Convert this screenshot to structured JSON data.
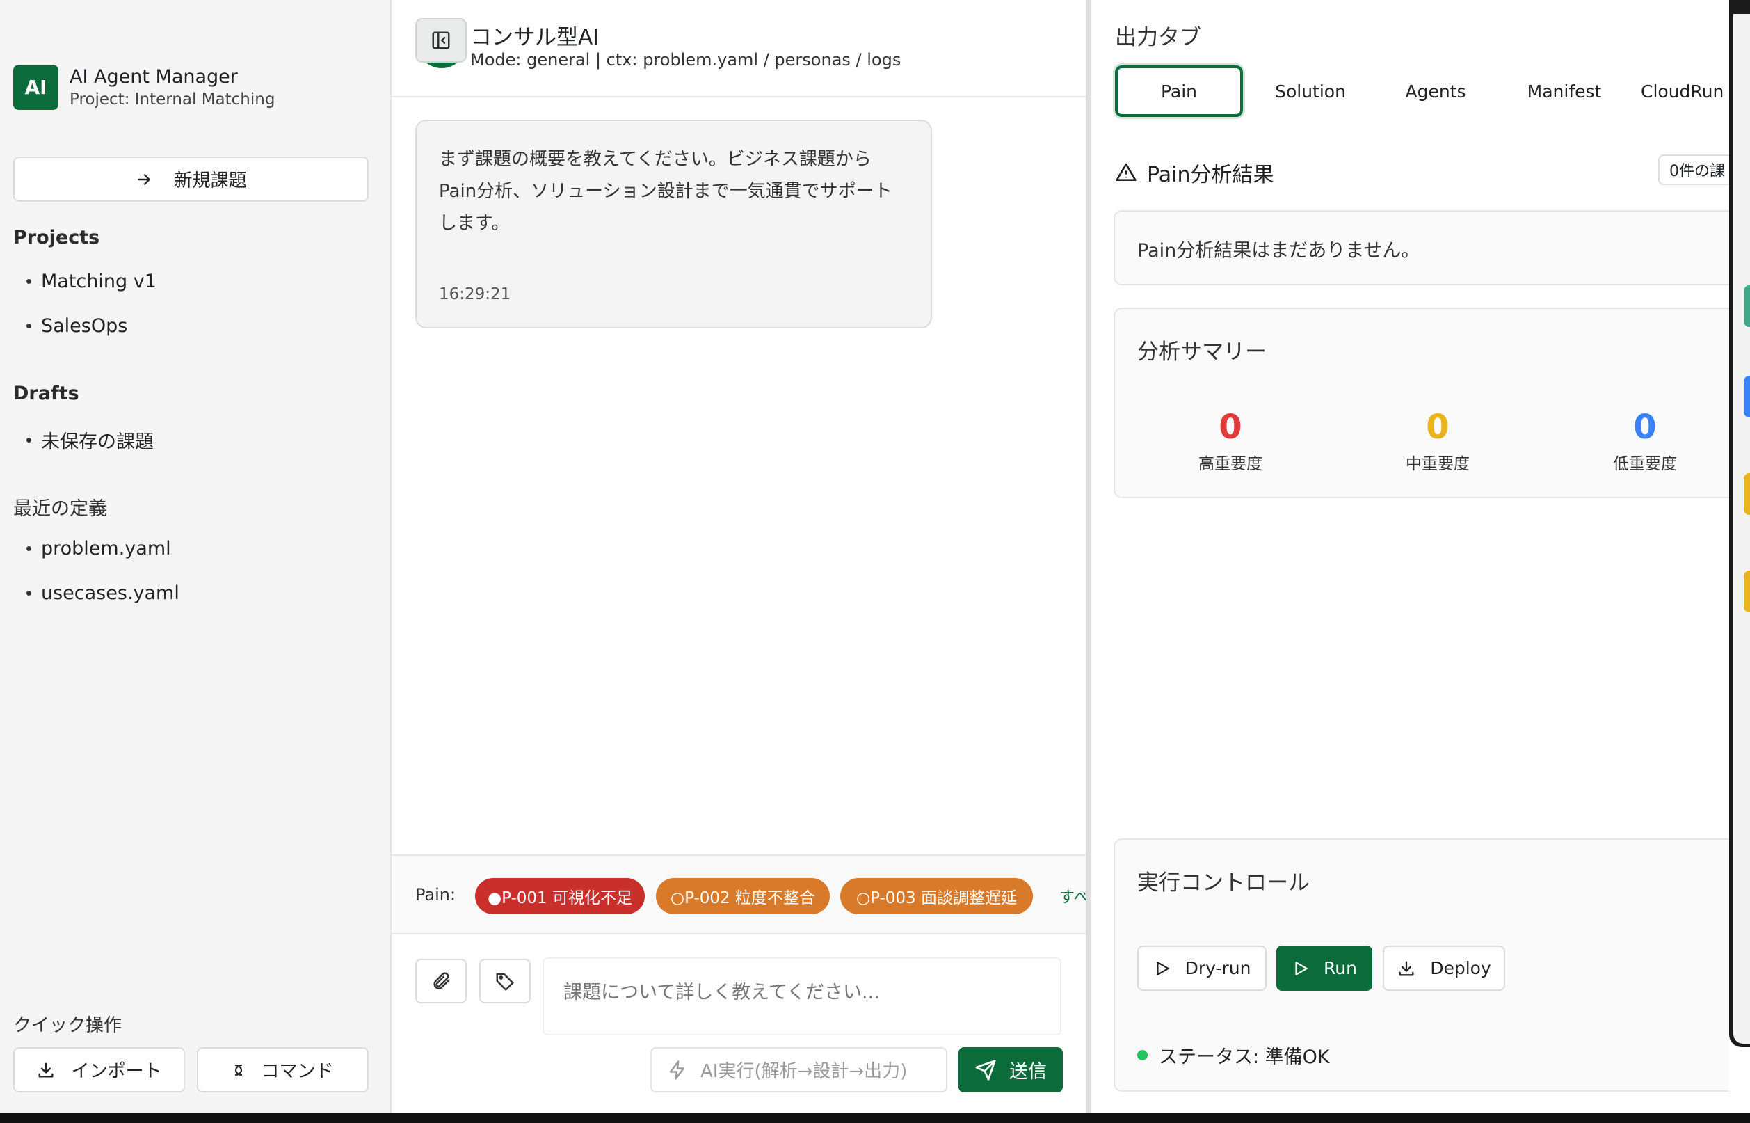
{
  "sidebar": {
    "logo": "AI",
    "title": "AI Agent Manager",
    "subtitle": "Project: Internal Matching",
    "new_issue": "新規課題",
    "projects_title": "Projects",
    "projects": [
      "Matching v1",
      "SalesOps"
    ],
    "drafts_title": "Drafts",
    "drafts": [
      "未保存の課題"
    ],
    "recent_title": "最近の定義",
    "recent": [
      "problem.yaml",
      "usecases.yaml"
    ],
    "quick_title": "クイック操作",
    "import_label": "インポート",
    "command_label": "コマンド"
  },
  "chat": {
    "title": "コンサル型AI",
    "mode": "Mode: general | ctx: problem.yaml / personas / logs",
    "message": "まず課題の概要を教えてください。ビジネス課題からPain分析、ソリューション設計まで一気通貫でサポートします。",
    "message_time": "16:29:21",
    "pain_label": "Pain:",
    "chips": [
      "●P-001 可視化不足",
      "○P-002 粒度不整合",
      "○P-003 面談調整遅延"
    ],
    "more_label": "すべ",
    "input_placeholder": "課題について詳しく教えてください...",
    "ai_run_label": "AI実行(解析→設計→出力)",
    "send_label": "送信"
  },
  "panel": {
    "title": "出力タブ",
    "tabs": [
      "Pain",
      "Solution",
      "Agents",
      "Manifest",
      "CloudRun"
    ],
    "active_tab": "Pain",
    "pain_heading": "Pain分析結果",
    "count_badge": "0件の課",
    "empty_text": "Pain分析結果はまだありません。",
    "summary_title": "分析サマリー",
    "stats": [
      {
        "value": "0",
        "label": "高重要度",
        "color": "#e03b3b"
      },
      {
        "value": "0",
        "label": "中重要度",
        "color": "#e8b31c"
      },
      {
        "value": "0",
        "label": "低重要度",
        "color": "#3b82f6"
      }
    ],
    "control_title": "実行コントロール",
    "dry_run": "Dry-run",
    "run": "Run",
    "deploy": "Deploy",
    "status": "ステータス: 準備OK"
  },
  "colors": {
    "brand": "#0b6b3a",
    "chip_red": "#c9302c",
    "chip_orange": "#d97a2b",
    "status_ok": "#22c55e"
  }
}
